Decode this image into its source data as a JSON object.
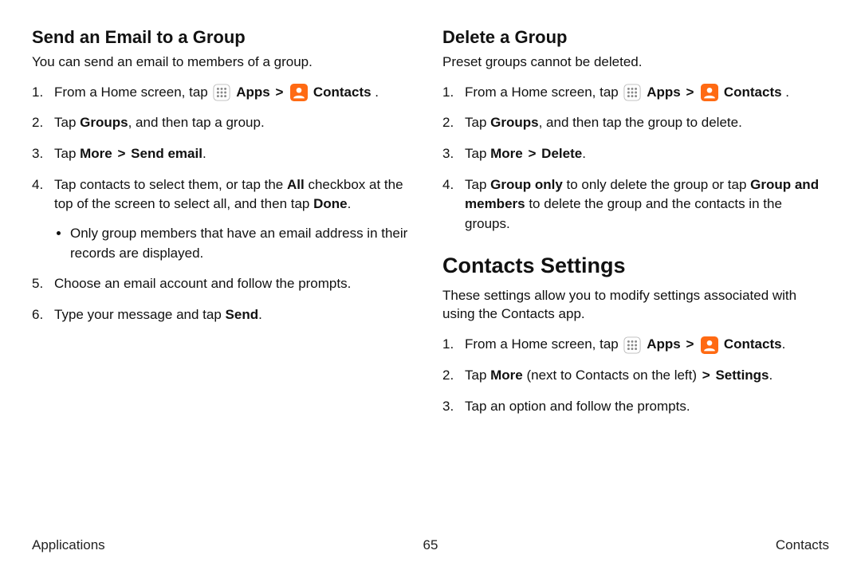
{
  "left": {
    "heading": "Send an Email to a Group",
    "intro": "You can send an email to members of a group.",
    "step1": {
      "pre": "From a Home screen, tap ",
      "apps": "Apps",
      "contacts": "Contacts",
      "post": " ."
    },
    "step2": {
      "a": "Tap ",
      "b": "Groups",
      "c": ", and then tap a group."
    },
    "step3": {
      "a": "Tap ",
      "b": "More",
      "c": "Send email",
      "d": "."
    },
    "step4": {
      "a": "Tap contacts to select them, or tap the ",
      "b": "All",
      "c": " checkbox at the top of the screen to select all, and then tap ",
      "d": "Done",
      "e": "."
    },
    "step4_sub": "Only group members that have an email address in their records are displayed.",
    "step5": "Choose an email account and follow the prompts.",
    "step6": {
      "a": "Type your message and tap ",
      "b": "Send",
      "c": "."
    }
  },
  "right": {
    "del_heading": "Delete a Group",
    "del_intro": "Preset groups cannot be deleted.",
    "del_step1": {
      "pre": "From a Home screen, tap ",
      "apps": "Apps",
      "contacts": "Contacts",
      "post": " ."
    },
    "del_step2": {
      "a": "Tap ",
      "b": "Groups",
      "c": ", and then tap the group to delete."
    },
    "del_step3": {
      "a": "Tap ",
      "b": "More",
      "c": "Delete",
      "d": "."
    },
    "del_step4": {
      "a": "Tap ",
      "b": "Group only",
      "c": " to only delete the group or tap ",
      "d": "Group and members",
      "e": " to delete the group and the contacts in the groups."
    },
    "cs_heading": "Contacts Settings",
    "cs_intro": "These settings allow you to modify settings associated with using the Contacts app.",
    "cs_step1": {
      "pre": "From a Home screen, tap ",
      "apps": "Apps",
      "contacts": "Contacts",
      "post": "."
    },
    "cs_step2": {
      "a": "Tap ",
      "b": "More",
      "c": " (next to Contacts on the left) ",
      "d": "Settings",
      "e": "."
    },
    "cs_step3": "Tap an option and follow the prompts."
  },
  "footer": {
    "left": "Applications",
    "center": "65",
    "right": "Contacts"
  },
  "chevron": ">"
}
